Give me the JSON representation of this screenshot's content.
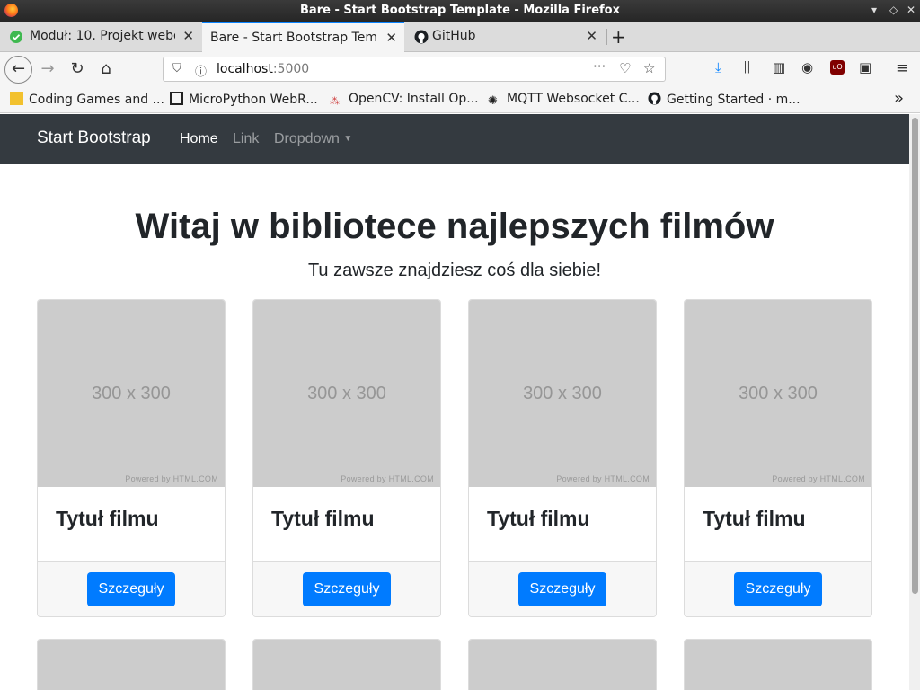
{
  "window": {
    "title": "Bare - Start Bootstrap Template - Mozilla Firefox"
  },
  "tabs": [
    {
      "label": "Moduł: 10. Projekt webo",
      "icon": "check-circle-icon",
      "active": false
    },
    {
      "label": "Bare - Start Bootstrap Temp",
      "icon": "",
      "active": true
    },
    {
      "label": "GitHub",
      "icon": "github-icon",
      "active": false
    }
  ],
  "urlbar": {
    "host": "localhost",
    "port": ":5000"
  },
  "bookmarks": [
    {
      "label": "Coding Games and ...",
      "icon": "codingame-icon"
    },
    {
      "label": "MicroPython WebR...",
      "icon": "micropython-icon"
    },
    {
      "label": "OpenCV: Install Op...",
      "icon": "opencv-icon"
    },
    {
      "label": "MQTT Websocket C...",
      "icon": "mqtt-icon"
    },
    {
      "label": "Getting Started · m...",
      "icon": "github-icon"
    }
  ],
  "site": {
    "brand": "Start Bootstrap",
    "nav": [
      {
        "label": "Home",
        "active": true
      },
      {
        "label": "Link",
        "active": false
      },
      {
        "label": "Dropdown",
        "active": false
      }
    ],
    "hero_title": "Witaj w bibliotece najlepszych filmów",
    "hero_subtitle": "Tu zawsze znajdziesz coś dla siebie!"
  },
  "cards": [
    {
      "image_text": "300 x 300",
      "powered": "Powered by HTML.COM",
      "title": "Tytuł filmu",
      "button": "Szczeguły"
    },
    {
      "image_text": "300 x 300",
      "powered": "Powered by HTML.COM",
      "title": "Tytuł filmu",
      "button": "Szczeguły"
    },
    {
      "image_text": "300 x 300",
      "powered": "Powered by HTML.COM",
      "title": "Tytuł filmu",
      "button": "Szczeguły"
    },
    {
      "image_text": "300 x 300",
      "powered": "Powered by HTML.COM",
      "title": "Tytuł filmu",
      "button": "Szczeguły"
    }
  ],
  "colors": {
    "primary": "#007bff",
    "navbar": "#343a40",
    "placeholder": "#cccccc"
  }
}
